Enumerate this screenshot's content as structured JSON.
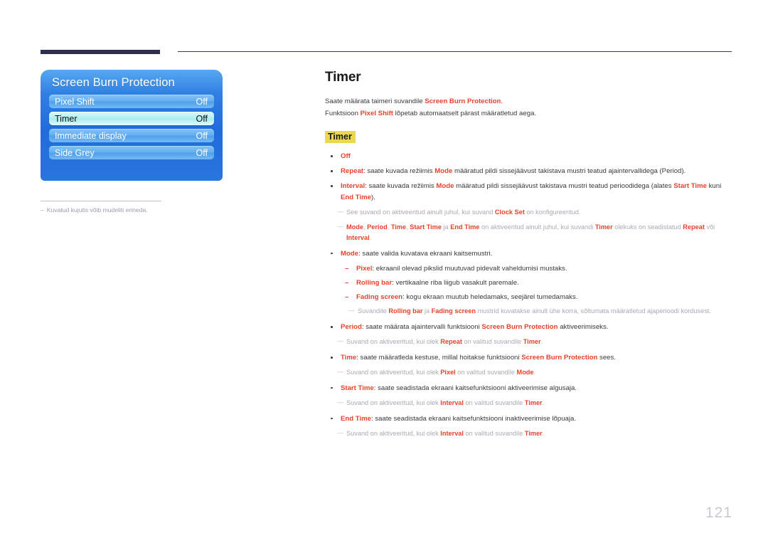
{
  "page": {
    "number": "121"
  },
  "osd": {
    "title": "Screen Burn Protection",
    "rows": [
      {
        "label": "Pixel Shift",
        "value": "Off",
        "selected": false
      },
      {
        "label": "Timer",
        "value": "Off",
        "selected": true
      },
      {
        "label": "Immediate display",
        "value": "Off",
        "selected": false
      },
      {
        "label": "Side Grey",
        "value": "Off",
        "selected": false
      }
    ],
    "caption": {
      "dash": "–",
      "text": "Kuvatud kujutis võib mudeliti erineda."
    }
  },
  "content": {
    "title": "Timer",
    "intro": [
      {
        "pre": "Saate määrata taimeri suvandile ",
        "em1": "Screen Burn Protection",
        "post": "."
      },
      {
        "pre": "Funktsioon ",
        "em1": "Pixel Shift",
        "post": " lõpetab automaatselt pärast määratletud aega."
      }
    ],
    "sub_head": "Timer",
    "items": {
      "off": {
        "term": "Off"
      },
      "repeat": {
        "term": "Repeat",
        "seg1": ": saate kuvada režiimis ",
        "em2": "Mode",
        "seg2": " määratud pildi sissejäävust takistava mustri teatud ajaintervallidega (Period)."
      },
      "interval": {
        "term": "Interval",
        "seg1": ": saate kuvada režiimis ",
        "em2": "Mode",
        "seg2": " määratud pildi sissejäävust takistava mustri teatud perioodidega (alates ",
        "em3": "Start Time",
        "seg3": " kuni ",
        "em4": "End Time",
        "seg4": ")."
      },
      "note_clock": {
        "seg1": "See suvand on aktiveeritud ainult juhul, kui suvand ",
        "em1": "Clock Set",
        "seg2": " on konfigureeritud."
      },
      "note_modes": {
        "em1": "Mode",
        "s1": ", ",
        "em2": "Period",
        "s2": ", ",
        "em3": "Time",
        "s3": ", ",
        "em4": "Start Time",
        "s4": " ja ",
        "em5": "End Time",
        "s5": " on aktiveeritud ainult juhul, kui suvandi ",
        "em6": "Timer",
        "s6": " olekuks on seadistatud ",
        "em7": "Repeat",
        "s7": " või ",
        "em8": "Interval",
        "s8": "."
      },
      "mode": {
        "term": "Mode",
        "seg1": ": saate valida kuvatava ekraani kaitsemustri."
      },
      "pixel": {
        "term": "Pixel",
        "seg1": ": ekraanil olevad pikslid muutuvad pidevalt vaheldumisi mustaks."
      },
      "rolling_bar": {
        "term": "Rolling bar",
        "seg1": ": vertikaalne riba liigub vasakult paremale."
      },
      "fading_screen": {
        "term": "Fading screen",
        "seg1": ": kogu ekraan muutub heledamaks, seejärel tumedamaks."
      },
      "note_patterns": {
        "seg1": "Suvandite ",
        "em1": "Rolling bar",
        "seg2": " ja ",
        "em2": "Fading screen",
        "seg3": " mustrid kuvatakse ainult ühe korra, sõltumata määratletud ajaperioodi kordusest."
      },
      "period": {
        "term": "Period",
        "seg1": ": saate määrata ajaintervalli funktsiooni ",
        "em2": "Screen Burn Protection",
        "seg2": " aktiveerimiseks."
      },
      "note_period": {
        "seg1": "Suvand on aktiveeritud, kui olek ",
        "em1": "Repeat",
        "seg2": " on valitud suvandile ",
        "em2": "Timer",
        "seg3": "."
      },
      "time": {
        "term": "Time",
        "seg1": ": saate määratleda kestuse, millal hoitakse funktsiooni ",
        "em2": "Screen Burn Protection",
        "seg2": " sees."
      },
      "note_time": {
        "seg1": "Suvand on aktiveeritud, kui olek ",
        "em1": "Pixel",
        "seg2": " on valitud suvandile ",
        "em2": "Mode",
        "seg3": "."
      },
      "start_time": {
        "term": "Start Time",
        "seg1": ": saate seadistada ekraani kaitsefunktsiooni aktiveerimise algusaja."
      },
      "note_start": {
        "seg1": "Suvand on aktiveeritud, kui olek ",
        "em1": "Interval",
        "seg2": " on valitud suvandile ",
        "em2": "Timer",
        "seg3": "."
      },
      "end_time": {
        "term": "End Time",
        "seg1": ": saate seadistada ekraani kaitsefunktsiooni inaktiveerimise lõpuaja."
      },
      "note_end": {
        "seg1": "Suvand on aktiveeritud, kui olek ",
        "em1": "Interval",
        "seg2": " on valitud suvandile ",
        "em2": "Timer",
        "seg3": "."
      }
    }
  },
  "colors": {
    "emphasis": "#e8412a",
    "highlight": "#ebd84e",
    "header_bar": "#2e2e4f",
    "osd_blue": "#2f7fe4",
    "note_grey": "#a9aab4"
  }
}
